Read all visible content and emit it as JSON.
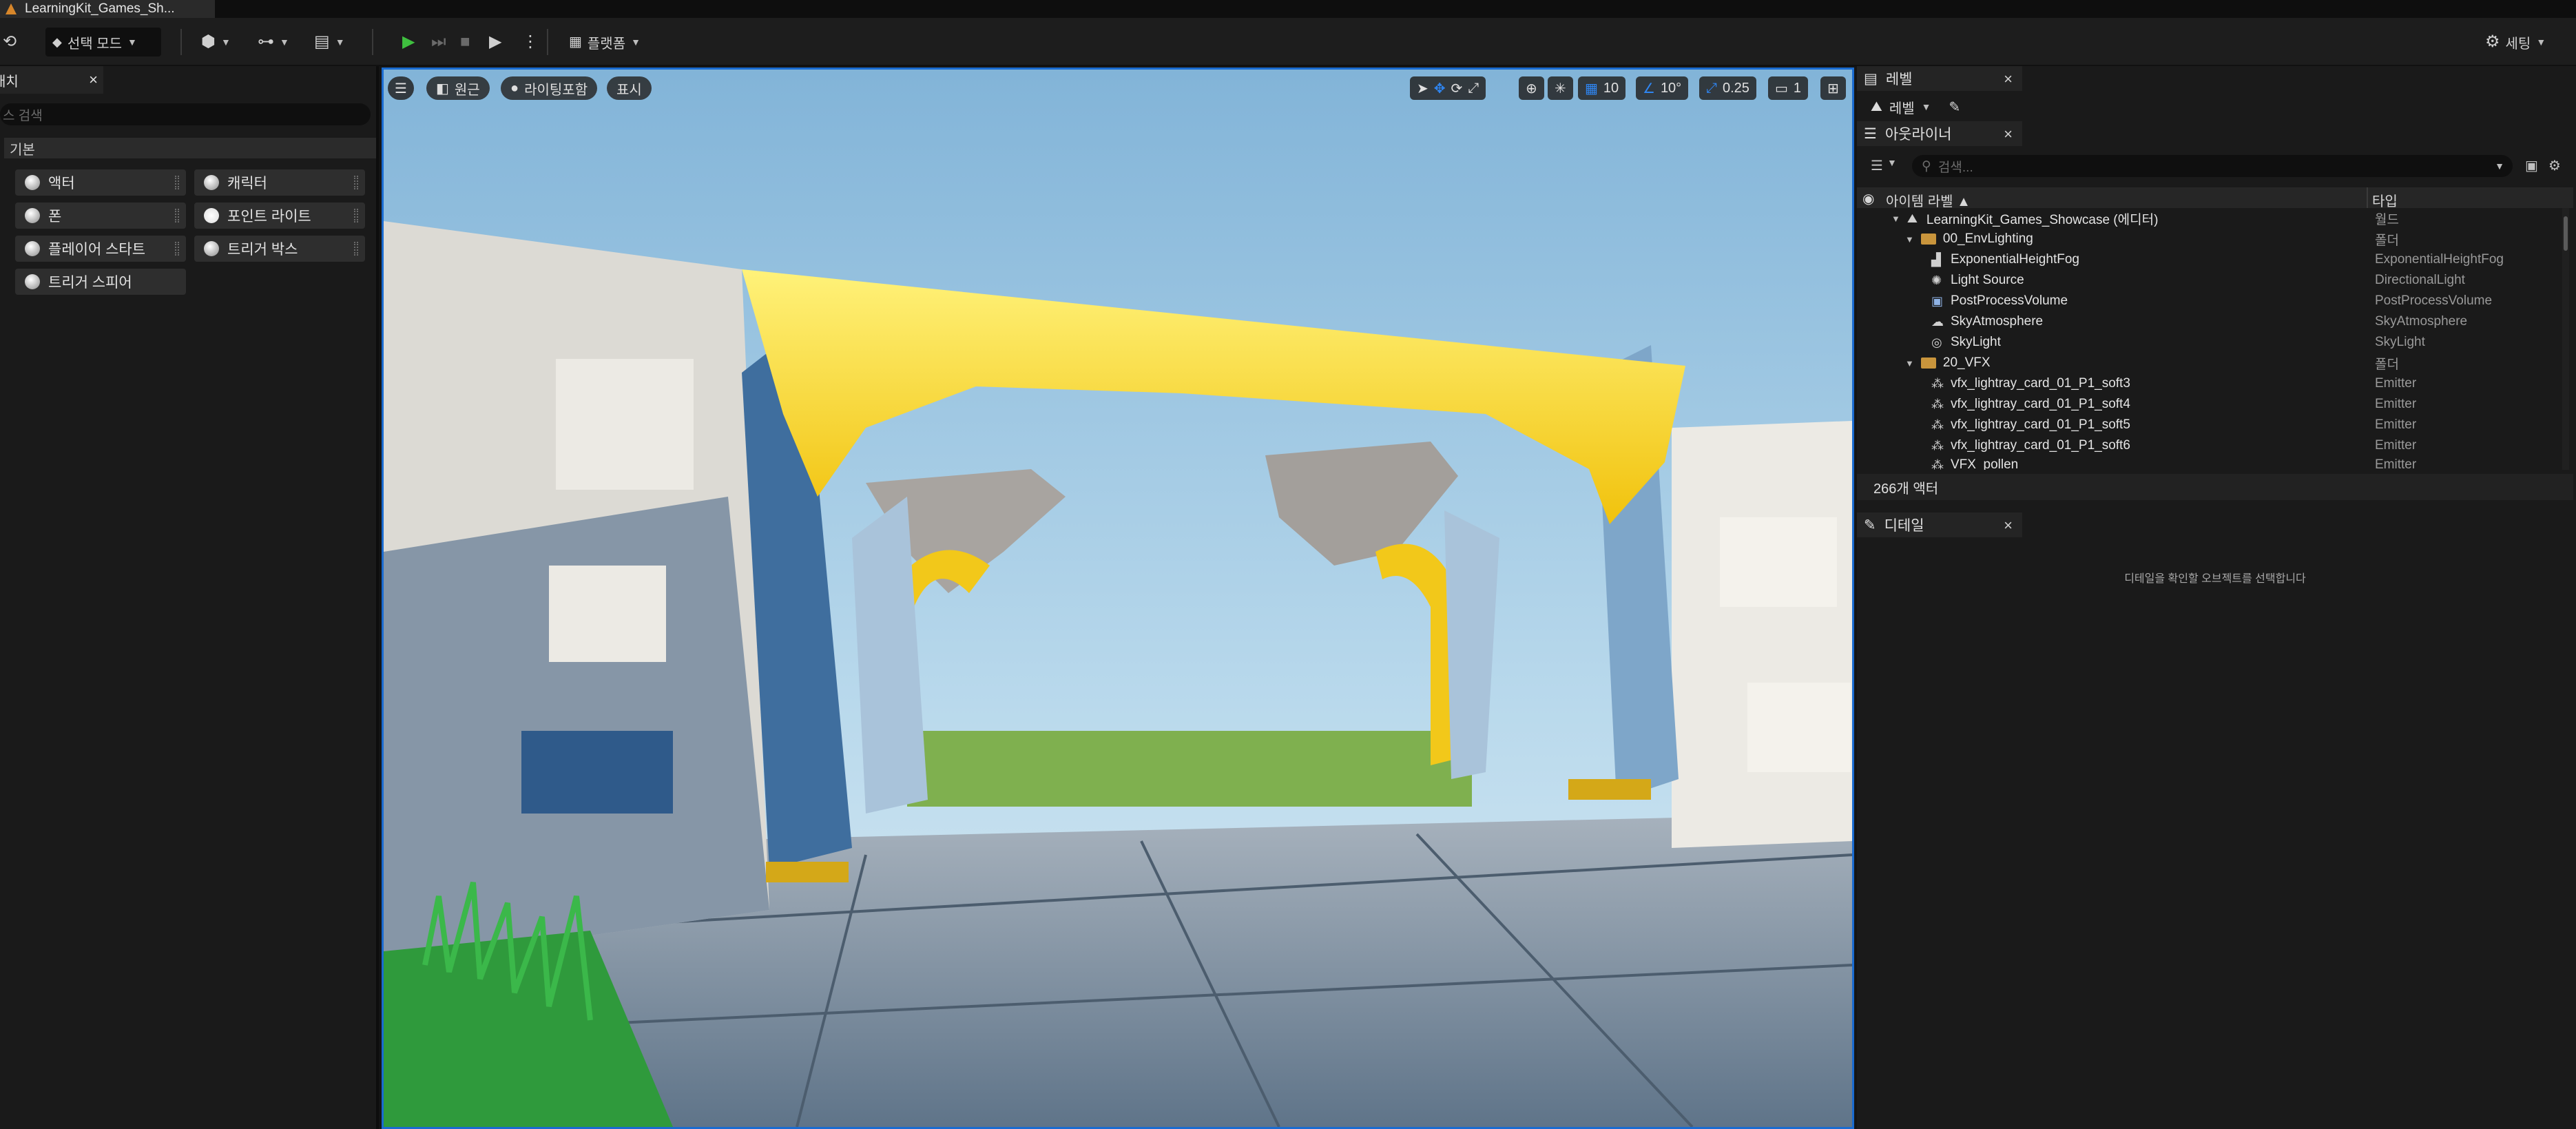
{
  "titlebar": {
    "doc_tab": "LearningKit_Games_Sh..."
  },
  "toolbar": {
    "select_mode_label": "선택 모드",
    "platforms_label": "플랫폼",
    "settings_label": "세팅"
  },
  "place_actors": {
    "tab_label": "배치",
    "search_placeholder": "스 검색",
    "category": "기본",
    "items": [
      "액터",
      "캐릭터",
      "폰",
      "포인트 라이트",
      "플레이어 스타트",
      "트리거 박스",
      "트리거 스피어"
    ]
  },
  "viewport": {
    "perspective_label": "원근",
    "lit_label": "라이팅포함",
    "show_label": "표시",
    "grid_snap": "10",
    "rotation_snap": "10°",
    "scale_snap": "0.25",
    "camera_speed": "1"
  },
  "levels": {
    "tab_label": "레벨",
    "dropdown_label": "레벨"
  },
  "outliner": {
    "tab_label": "아웃라이너",
    "search_placeholder": "검색...",
    "col_label": "아이템 라벨",
    "col_type": "타입",
    "rows": [
      {
        "label": "LearningKit_Games_Showcase (에디터)",
        "type": "월드"
      },
      {
        "label": "00_EnvLighting",
        "type": "폴더"
      },
      {
        "label": "ExponentialHeightFog",
        "type": "ExponentialHeightFog"
      },
      {
        "label": "Light Source",
        "type": "DirectionalLight"
      },
      {
        "label": "PostProcessVolume",
        "type": "PostProcessVolume"
      },
      {
        "label": "SkyAtmosphere",
        "type": "SkyAtmosphere"
      },
      {
        "label": "SkyLight",
        "type": "SkyLight"
      },
      {
        "label": "20_VFX",
        "type": "폴더"
      },
      {
        "label": "vfx_lightray_card_01_P1_soft3",
        "type": "Emitter"
      },
      {
        "label": "vfx_lightray_card_01_P1_soft4",
        "type": "Emitter"
      },
      {
        "label": "vfx_lightray_card_01_P1_soft5",
        "type": "Emitter"
      },
      {
        "label": "vfx_lightray_card_01_P1_soft6",
        "type": "Emitter"
      },
      {
        "label": "VFX_pollen",
        "type": "Emitter"
      }
    ],
    "status": "266개 액터"
  },
  "details": {
    "tab_label": "디테일",
    "empty_message": "디테일을 확인할 오브젝트를 선택합니다"
  }
}
